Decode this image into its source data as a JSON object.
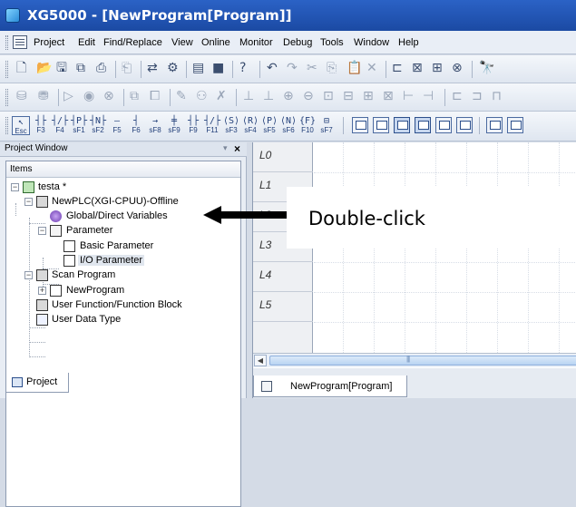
{
  "window": {
    "title": "XG5000 - [NewProgram[Program]]"
  },
  "menu": [
    "Project",
    "Edit",
    "Find/Replace",
    "View",
    "Online",
    "Monitor",
    "Debug",
    "Tools",
    "Window",
    "Help"
  ],
  "toolbar_fkeys": [
    {
      "sym": "↖",
      "label": "Esc"
    },
    {
      "sym": "┤├",
      "label": "F3"
    },
    {
      "sym": "┤/├",
      "label": "F4"
    },
    {
      "sym": "┤P├",
      "label": "sF1"
    },
    {
      "sym": "┤N├",
      "label": "sF2"
    },
    {
      "sym": "—",
      "label": "F5"
    },
    {
      "sym": "┤",
      "label": "F6"
    },
    {
      "sym": "→",
      "label": "sF8"
    },
    {
      "sym": "╪",
      "label": "sF9"
    },
    {
      "sym": "┤├",
      "label": "F9"
    },
    {
      "sym": "┤/├",
      "label": "F11"
    },
    {
      "sym": "⟨S⟩",
      "label": "sF3"
    },
    {
      "sym": "⟨R⟩",
      "label": "sF4"
    },
    {
      "sym": "⟨P⟩",
      "label": "sF5"
    },
    {
      "sym": "⟨N⟩",
      "label": "sF6"
    },
    {
      "sym": "{F}",
      "label": "F10"
    },
    {
      "sym": "⊟",
      "label": "sF7"
    }
  ],
  "project_window": {
    "title": "Project Window",
    "header": "Items",
    "tree": {
      "root": "testa *",
      "plc": "NewPLC(XGI-CPUU)-Offline",
      "global_vars": "Global/Direct Variables",
      "parameter": "Parameter",
      "basic_param": "Basic Parameter",
      "io_param": "I/O Parameter",
      "scan_program": "Scan Program",
      "new_program": "NewProgram",
      "user_function": "User Function/Function Block",
      "user_data_type": "User Data Type"
    },
    "tab": "Project"
  },
  "editor": {
    "rows": [
      "L0",
      "L1",
      "L2",
      "L3",
      "L4",
      "L5"
    ],
    "tab": "NewProgram[Program]"
  },
  "annotation": {
    "text": "Double-click",
    "color": "#000000"
  },
  "colors": {
    "titlebar": "#2b62c6",
    "menubar": "#e9eef6",
    "selection": "#e0e6ee"
  }
}
